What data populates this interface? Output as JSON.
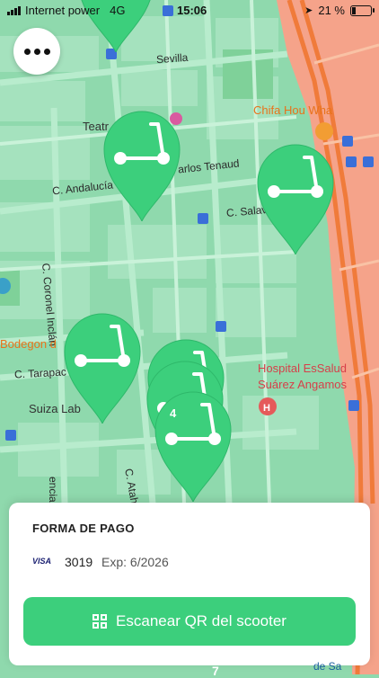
{
  "status": {
    "carrier": "Internet power",
    "network": "4G",
    "time": "15:06",
    "battery_text": "21 %",
    "battery_level": 0.21
  },
  "map": {
    "labels": {
      "sevilla": "Sevilla",
      "teatro": "Teatr",
      "chifa": "Chifa Hou Wha",
      "carlos_tenaud": "arlos Tenaud",
      "andalucia": "C. Andalucía",
      "salaverry": "C. Salav",
      "coronel": "C. Coronel Inclán",
      "bodegon": "Bodegon d",
      "tarapaca": "C. Tarapac",
      "hospital": "Hospital EsSalud",
      "hospital2": "Suárez Angamos",
      "suiza": "Suiza Lab",
      "atahualpa": "C. Atah",
      "valencia": "encia"
    },
    "cluster_count": "4",
    "colors": {
      "green": "#8fd9ad",
      "zone": "#f5a38a",
      "pin": "#3ccf7c"
    }
  },
  "payment": {
    "title": "FORMA DE PAGO",
    "card_brand": "VISA",
    "card_last4": "3019",
    "expiry": "Exp: 6/2026"
  },
  "scan_button": {
    "label": "Escanear QR del scooter"
  },
  "bottom": {
    "peek_label": "de Sa",
    "peek_num": "7"
  }
}
